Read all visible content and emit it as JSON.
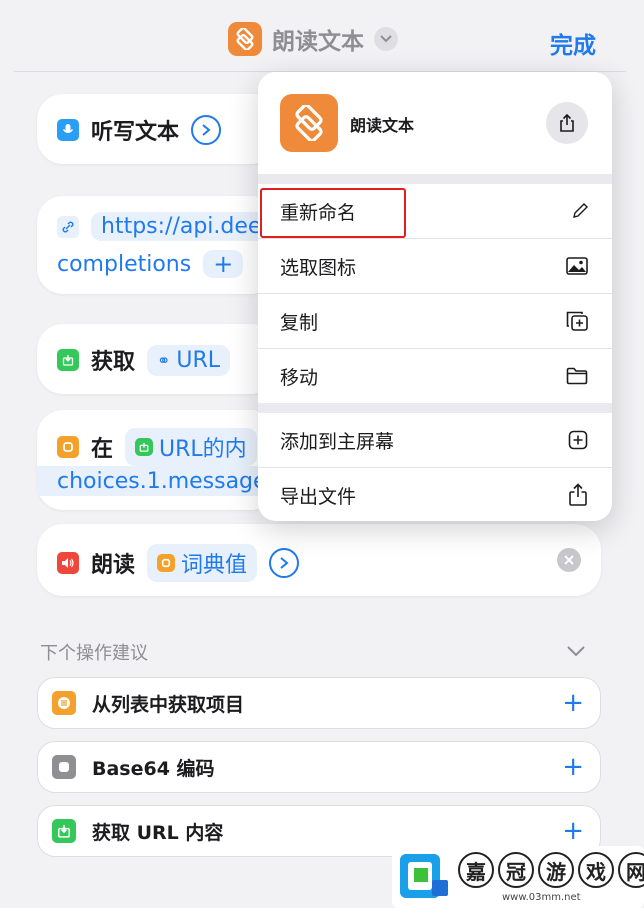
{
  "header": {
    "title": "朗读文本",
    "done_label": "完成"
  },
  "actions": {
    "dictate": {
      "label": "听写文本"
    },
    "url": {
      "text": "https://api.dee",
      "text2": "completions"
    },
    "get": {
      "label": "获取",
      "pill": "URL"
    },
    "dict": {
      "label": "在",
      "pill": "URL的内",
      "line2": "choices.1.message"
    },
    "speak": {
      "label": "朗读",
      "pill": "词典值"
    }
  },
  "menu": {
    "title": "朗读文本",
    "items": [
      {
        "label": "重新命名",
        "icon": "pencil-icon"
      },
      {
        "label": "选取图标",
        "icon": "image-icon"
      },
      {
        "label": "复制",
        "icon": "duplicate-icon"
      },
      {
        "label": "移动",
        "icon": "folder-icon"
      },
      {
        "label": "添加到主屏幕",
        "icon": "add-square-icon"
      },
      {
        "label": "导出文件",
        "icon": "share-icon"
      }
    ],
    "highlight_color": "#e02020"
  },
  "suggestions": {
    "heading": "下个操作建议",
    "items": [
      {
        "label": "从列表中获取项目",
        "color": "#f3a12b"
      },
      {
        "label": "Base64 编码",
        "color": "#8e8e93"
      },
      {
        "label": "获取 URL 内容",
        "color": "#34c759"
      }
    ]
  },
  "watermark": {
    "chars": [
      "嘉",
      "冠",
      "游",
      "戏",
      "网"
    ],
    "url": "www.03mm.net"
  },
  "colors": {
    "accent": "#1f7aed",
    "orange": "#ef8a3a",
    "background": "#f2f2f5"
  }
}
